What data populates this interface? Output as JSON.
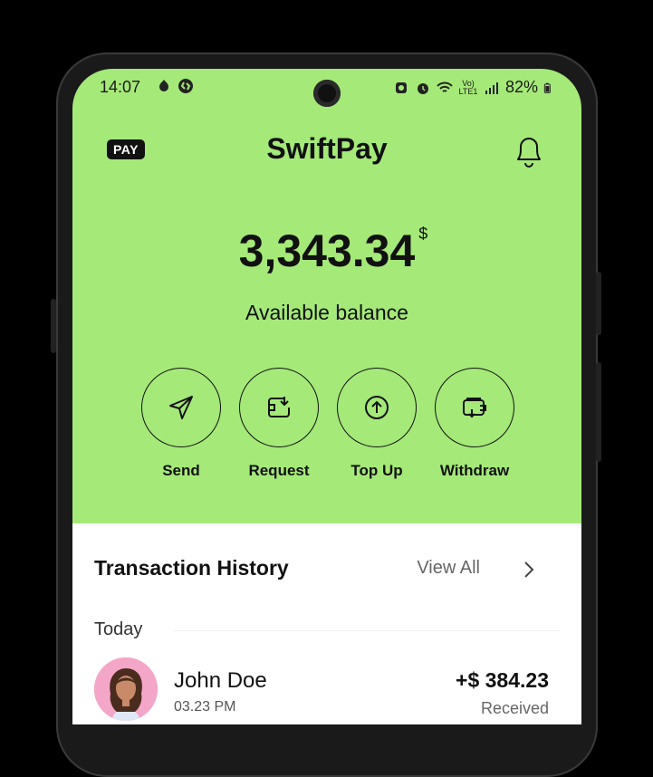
{
  "status_bar": {
    "time": "14:07",
    "battery": "82%",
    "left_icons": [
      "notification-icon",
      "shazam-icon"
    ],
    "right_icons": [
      "alarm-icon",
      "alarm-clock-icon",
      "wifi-icon",
      "volte-icon",
      "signal-icon",
      "battery-icon"
    ],
    "network_label": "Vo) LTE1"
  },
  "header": {
    "badge": "PAY",
    "title": "SwiftPay",
    "bell_icon": "bell-icon"
  },
  "balance": {
    "amount": "3,343.34",
    "currency": "$",
    "label": "Available balance"
  },
  "actions": [
    {
      "label": "Send",
      "icon": "send-icon"
    },
    {
      "label": "Request",
      "icon": "request-icon"
    },
    {
      "label": "Top Up",
      "icon": "top-up-icon"
    },
    {
      "label": "Withdraw",
      "icon": "withdraw-icon"
    }
  ],
  "transactions": {
    "title": "Transaction History",
    "view_all": "View All",
    "section": "Today",
    "items": [
      {
        "name": "John Doe",
        "time": "03.23 PM",
        "amount": "+$ 384.23",
        "status": "Received"
      }
    ]
  },
  "colors": {
    "accent": "#a5e979",
    "text": "#111111",
    "sheet": "#ffffff"
  }
}
